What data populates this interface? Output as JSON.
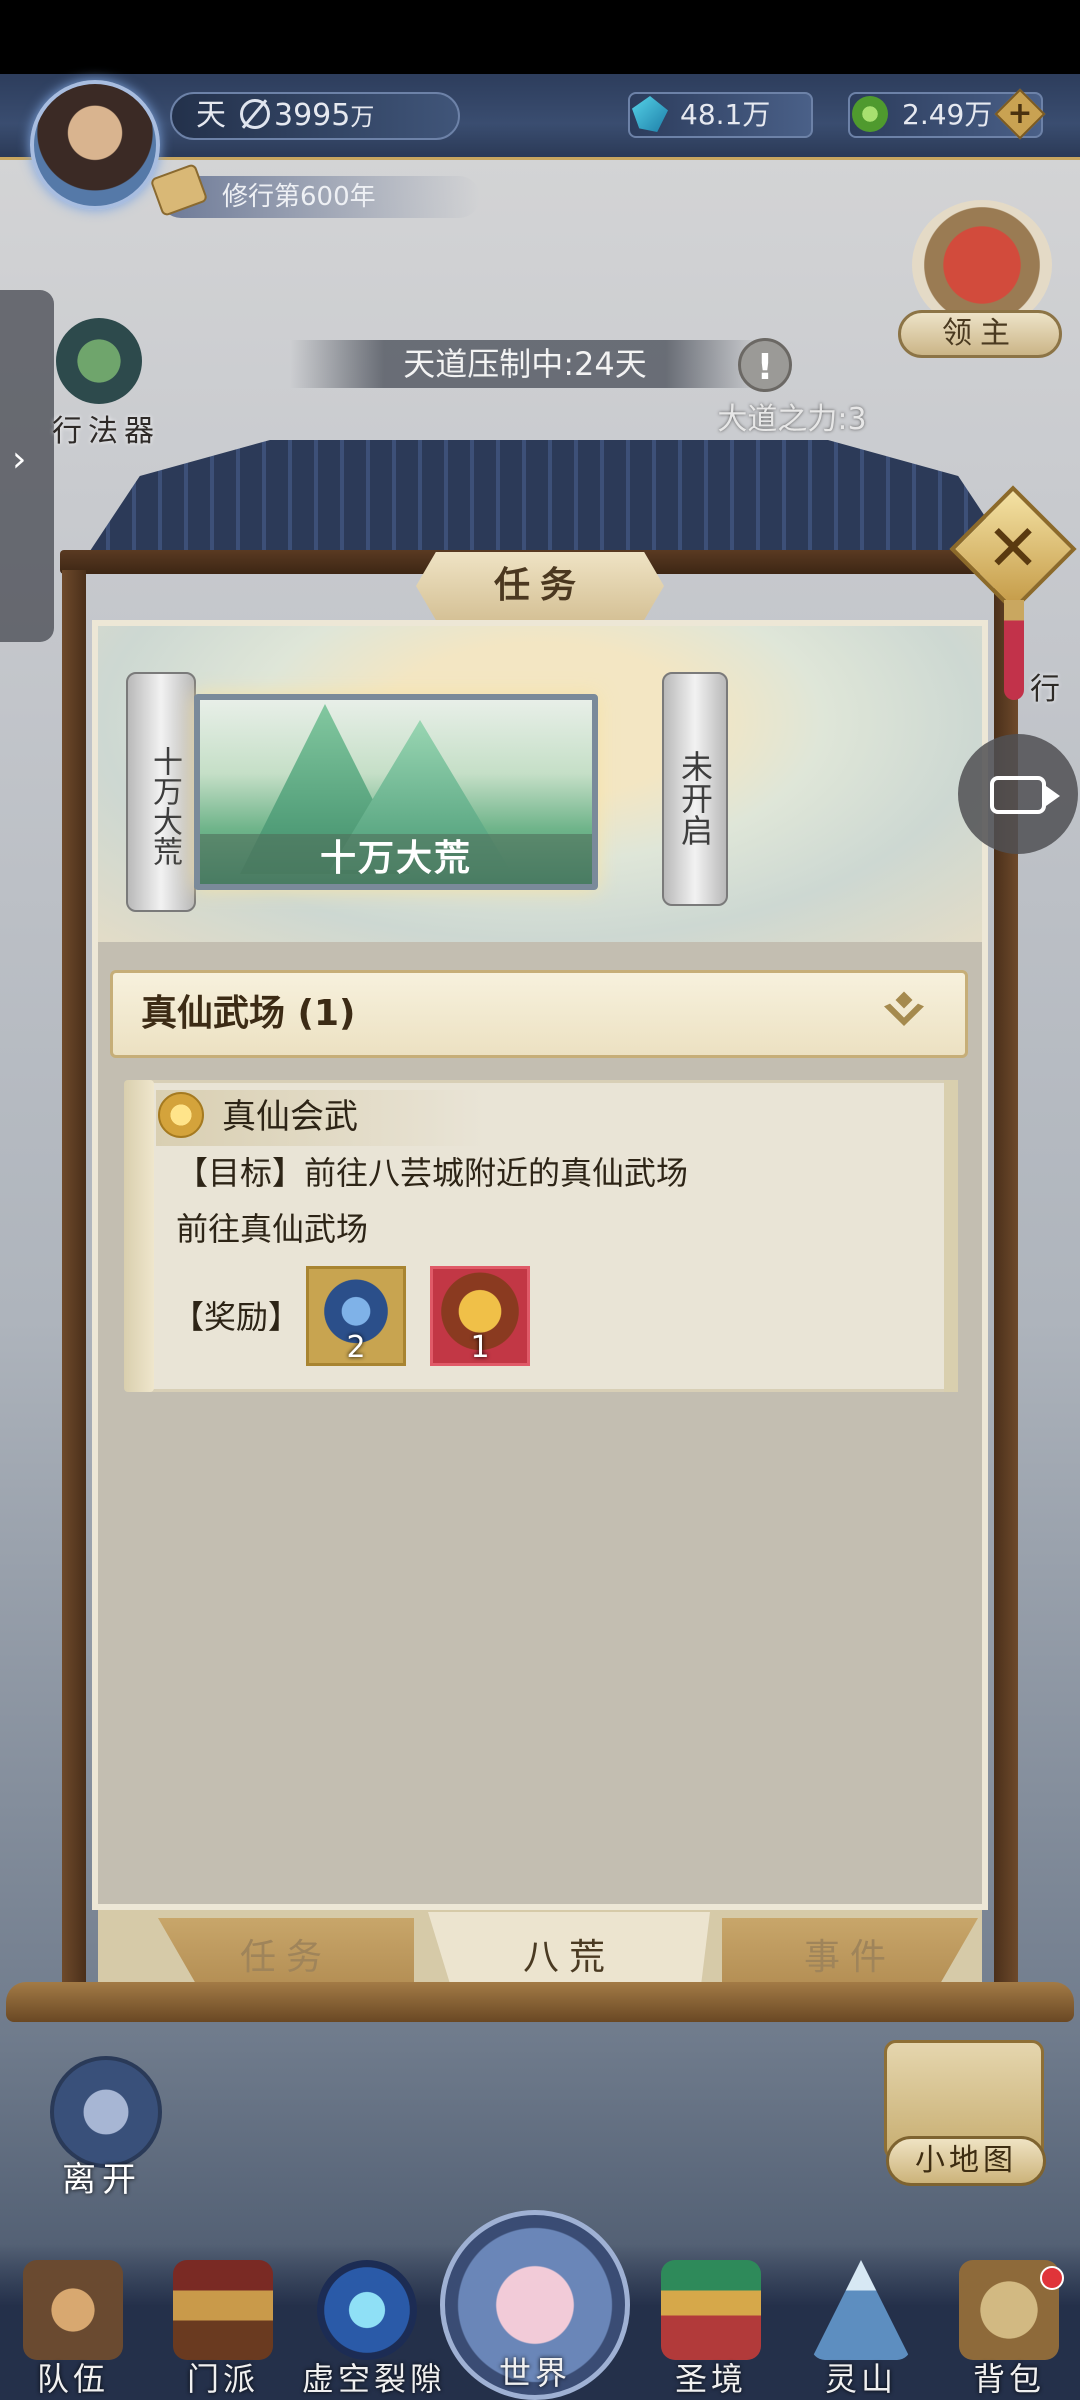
{
  "header": {
    "realm": "天",
    "power": "3995",
    "power_unit": "万",
    "resource_spirit": "48.1万",
    "resource_jade": "2.49万",
    "cultivation_years": "修行第600年"
  },
  "lord": {
    "label": "领主"
  },
  "left_side": {
    "artifact_label": "行法器"
  },
  "right_side": {
    "partial_label": "行"
  },
  "notice": {
    "suppression": "天道压制中:24天",
    "warning": "!",
    "dao_power": "大道之力:3"
  },
  "panel": {
    "title": "任务",
    "close": "✕",
    "region_scroll_left": "十万大荒",
    "region_card_label": "十万大荒",
    "region_scroll_right": "未开启",
    "category": "真仙武场 (1)",
    "task": {
      "title": "真仙会武",
      "goal": "【目标】前往八芸城附近的真仙武场",
      "description": "前往真仙武场",
      "reward_label": "【奖励】",
      "rewards": [
        {
          "icon": "taiji-orb-icon",
          "count": "2"
        },
        {
          "icon": "token-icon",
          "count": "1"
        }
      ]
    },
    "tabs": [
      "任务",
      "八荒",
      "事件"
    ],
    "active_tab": "八荒"
  },
  "buttons": {
    "leave": "离开",
    "minimap": "小地图"
  },
  "bottom_nav": [
    {
      "label": "队伍",
      "icon": "team-icon"
    },
    {
      "label": "门派",
      "icon": "sect-icon"
    },
    {
      "label": "虚空裂隙",
      "icon": "void-rift-icon"
    },
    {
      "label": "世界",
      "icon": "world-icon"
    },
    {
      "label": "圣境",
      "icon": "holy-realm-icon"
    },
    {
      "label": "灵山",
      "icon": "spirit-mountain-icon"
    },
    {
      "label": "背包",
      "icon": "backpack-icon"
    }
  ]
}
